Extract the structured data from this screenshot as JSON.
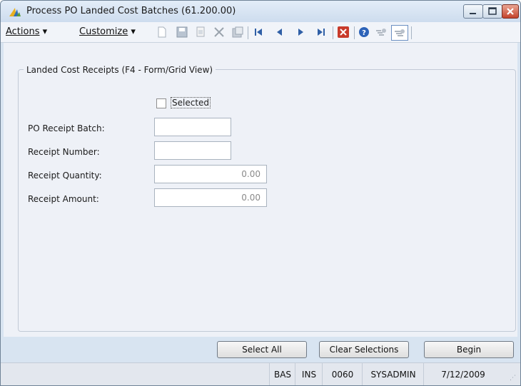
{
  "window": {
    "title": "Process PO Landed Cost Batches (61.200.00)",
    "accent": "#d8e4f1"
  },
  "menubar": {
    "actions_label": "Actions",
    "customize_label": "Customize"
  },
  "toolbar_icons": [
    "new-icon",
    "save-icon",
    "copy-icon",
    "delete-icon",
    "paste-icon",
    "first-record-icon",
    "previous-record-icon",
    "next-record-icon",
    "last-record-icon",
    "close-screen-icon",
    "help-icon",
    "link-icon",
    "note-icon"
  ],
  "group": {
    "title": "Landed Cost Receipts (F4 - Form/Grid View)"
  },
  "form": {
    "selected_label": "Selected",
    "selected_checked": false,
    "po_receipt_batch_label": "PO Receipt Batch:",
    "po_receipt_batch_value": "",
    "receipt_number_label": "Receipt Number:",
    "receipt_number_value": "",
    "receipt_quantity_label": "Receipt Quantity:",
    "receipt_quantity_value": "0.00",
    "receipt_amount_label": "Receipt Amount:",
    "receipt_amount_value": "0.00"
  },
  "buttons": {
    "select_all": "Select All",
    "clear_selections": "Clear Selections",
    "begin": "Begin"
  },
  "status": {
    "company": "BAS",
    "mode": "INS",
    "cpny_id": "0060",
    "user": "SYSADMIN",
    "date": "7/12/2009"
  }
}
